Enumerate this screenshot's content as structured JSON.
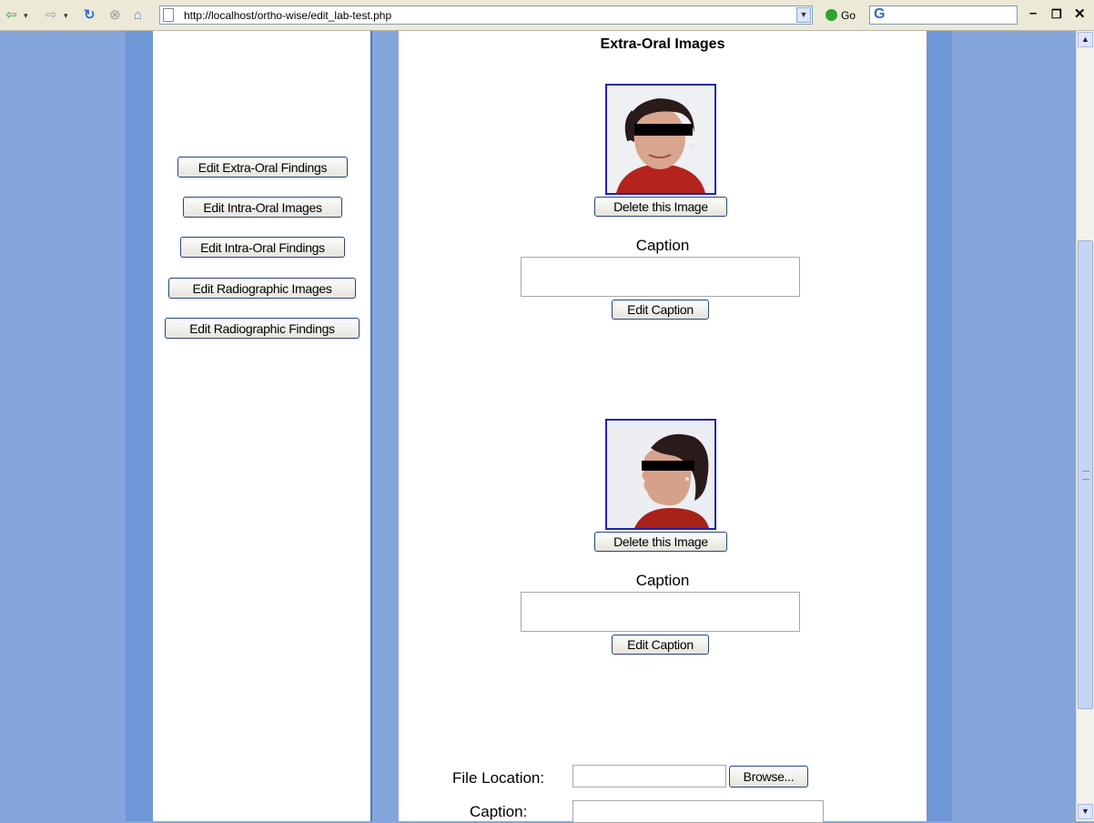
{
  "browser": {
    "address_url": "http://localhost/ortho-wise/edit_lab-test.php",
    "go_label": "Go",
    "google_logo": "G"
  },
  "sidebar": {
    "buttons": [
      "Edit Extra-Oral Findings",
      "Edit Intra-Oral Images",
      "Edit Intra-Oral Findings",
      "Edit Radiographic Images",
      "Edit Radiographic Findings"
    ]
  },
  "main": {
    "heading": "Extra-Oral Images",
    "images": [
      {
        "delete_label": "Delete this Image",
        "caption_label": "Caption",
        "caption_value": "",
        "edit_caption_label": "Edit Caption"
      },
      {
        "delete_label": "Delete this Image",
        "caption_label": "Caption",
        "caption_value": "",
        "edit_caption_label": "Edit Caption"
      }
    ],
    "upload": {
      "file_location_label": "File Location:",
      "file_value": "",
      "browse_label": "Browse...",
      "caption_label": "Caption:",
      "caption_value": ""
    }
  },
  "colors": {
    "page_bg": "#84a6dc",
    "button_border": "#27457a",
    "photo_border": "#2222aa"
  },
  "icons": [
    "back-arrow-icon",
    "forward-arrow-icon",
    "refresh-icon",
    "stop-icon",
    "home-icon",
    "page-icon",
    "go-icon",
    "minimize-icon",
    "restore-icon",
    "close-icon"
  ]
}
